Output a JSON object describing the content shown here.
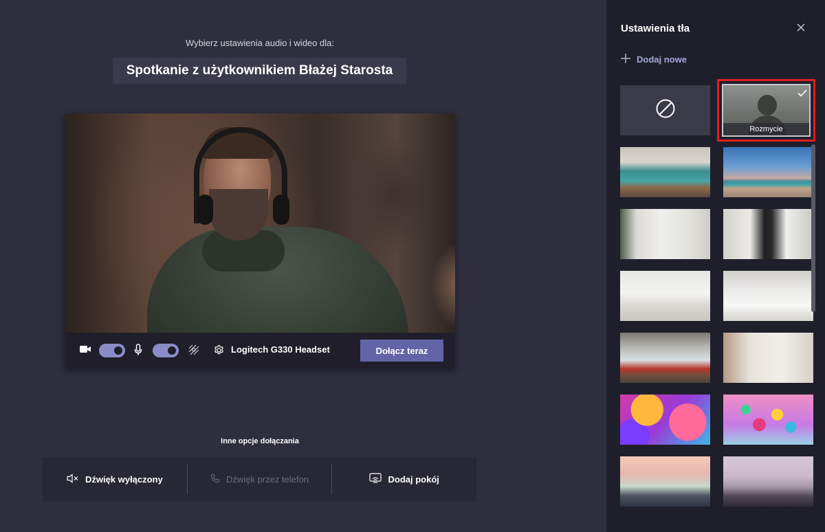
{
  "prejoin": {
    "subtitle": "Wybierz ustawienia audio i wideo dla:",
    "meeting_title": "Spotkanie z użytkownikiem Błażej Starosta"
  },
  "controls": {
    "camera_on": true,
    "mic_on": true,
    "device_label": "Logitech G330 Headset",
    "join_button": "Dołącz teraz"
  },
  "other_options": {
    "title": "Inne opcje dołączania",
    "items": [
      {
        "label": "Dźwięk wyłączony",
        "icon": "speaker-muted-icon",
        "enabled": true
      },
      {
        "label": "Dźwięk przez telefon",
        "icon": "phone-icon",
        "enabled": false
      },
      {
        "label": "Dodaj pokój",
        "icon": "cast-room-icon",
        "enabled": true
      }
    ]
  },
  "panel": {
    "title": "Ustawienia tła",
    "add_new": "Dodaj nowe",
    "selected_label": "Rozmycie",
    "backgrounds": [
      {
        "id": "none",
        "icon": "no-background-icon"
      },
      {
        "id": "blur",
        "label": "Rozmycie",
        "selected": true
      },
      {
        "id": "office-teal-lockers"
      },
      {
        "id": "beach-lifeguard"
      },
      {
        "id": "white-room-window"
      },
      {
        "id": "white-room-fireplace"
      },
      {
        "id": "bright-loft"
      },
      {
        "id": "white-studio"
      },
      {
        "id": "office-red-chairs"
      },
      {
        "id": "empty-beige-room"
      },
      {
        "id": "colorful-balls-large"
      },
      {
        "id": "colorful-balls-small"
      },
      {
        "id": "illustrated-bridge"
      },
      {
        "id": "illustrated-fantasy"
      }
    ]
  },
  "colors": {
    "accent": "#6264a7",
    "toggle_on": "#8b8cc7",
    "link": "#a6a7dc",
    "selection_highlight": "#e01e1e"
  }
}
